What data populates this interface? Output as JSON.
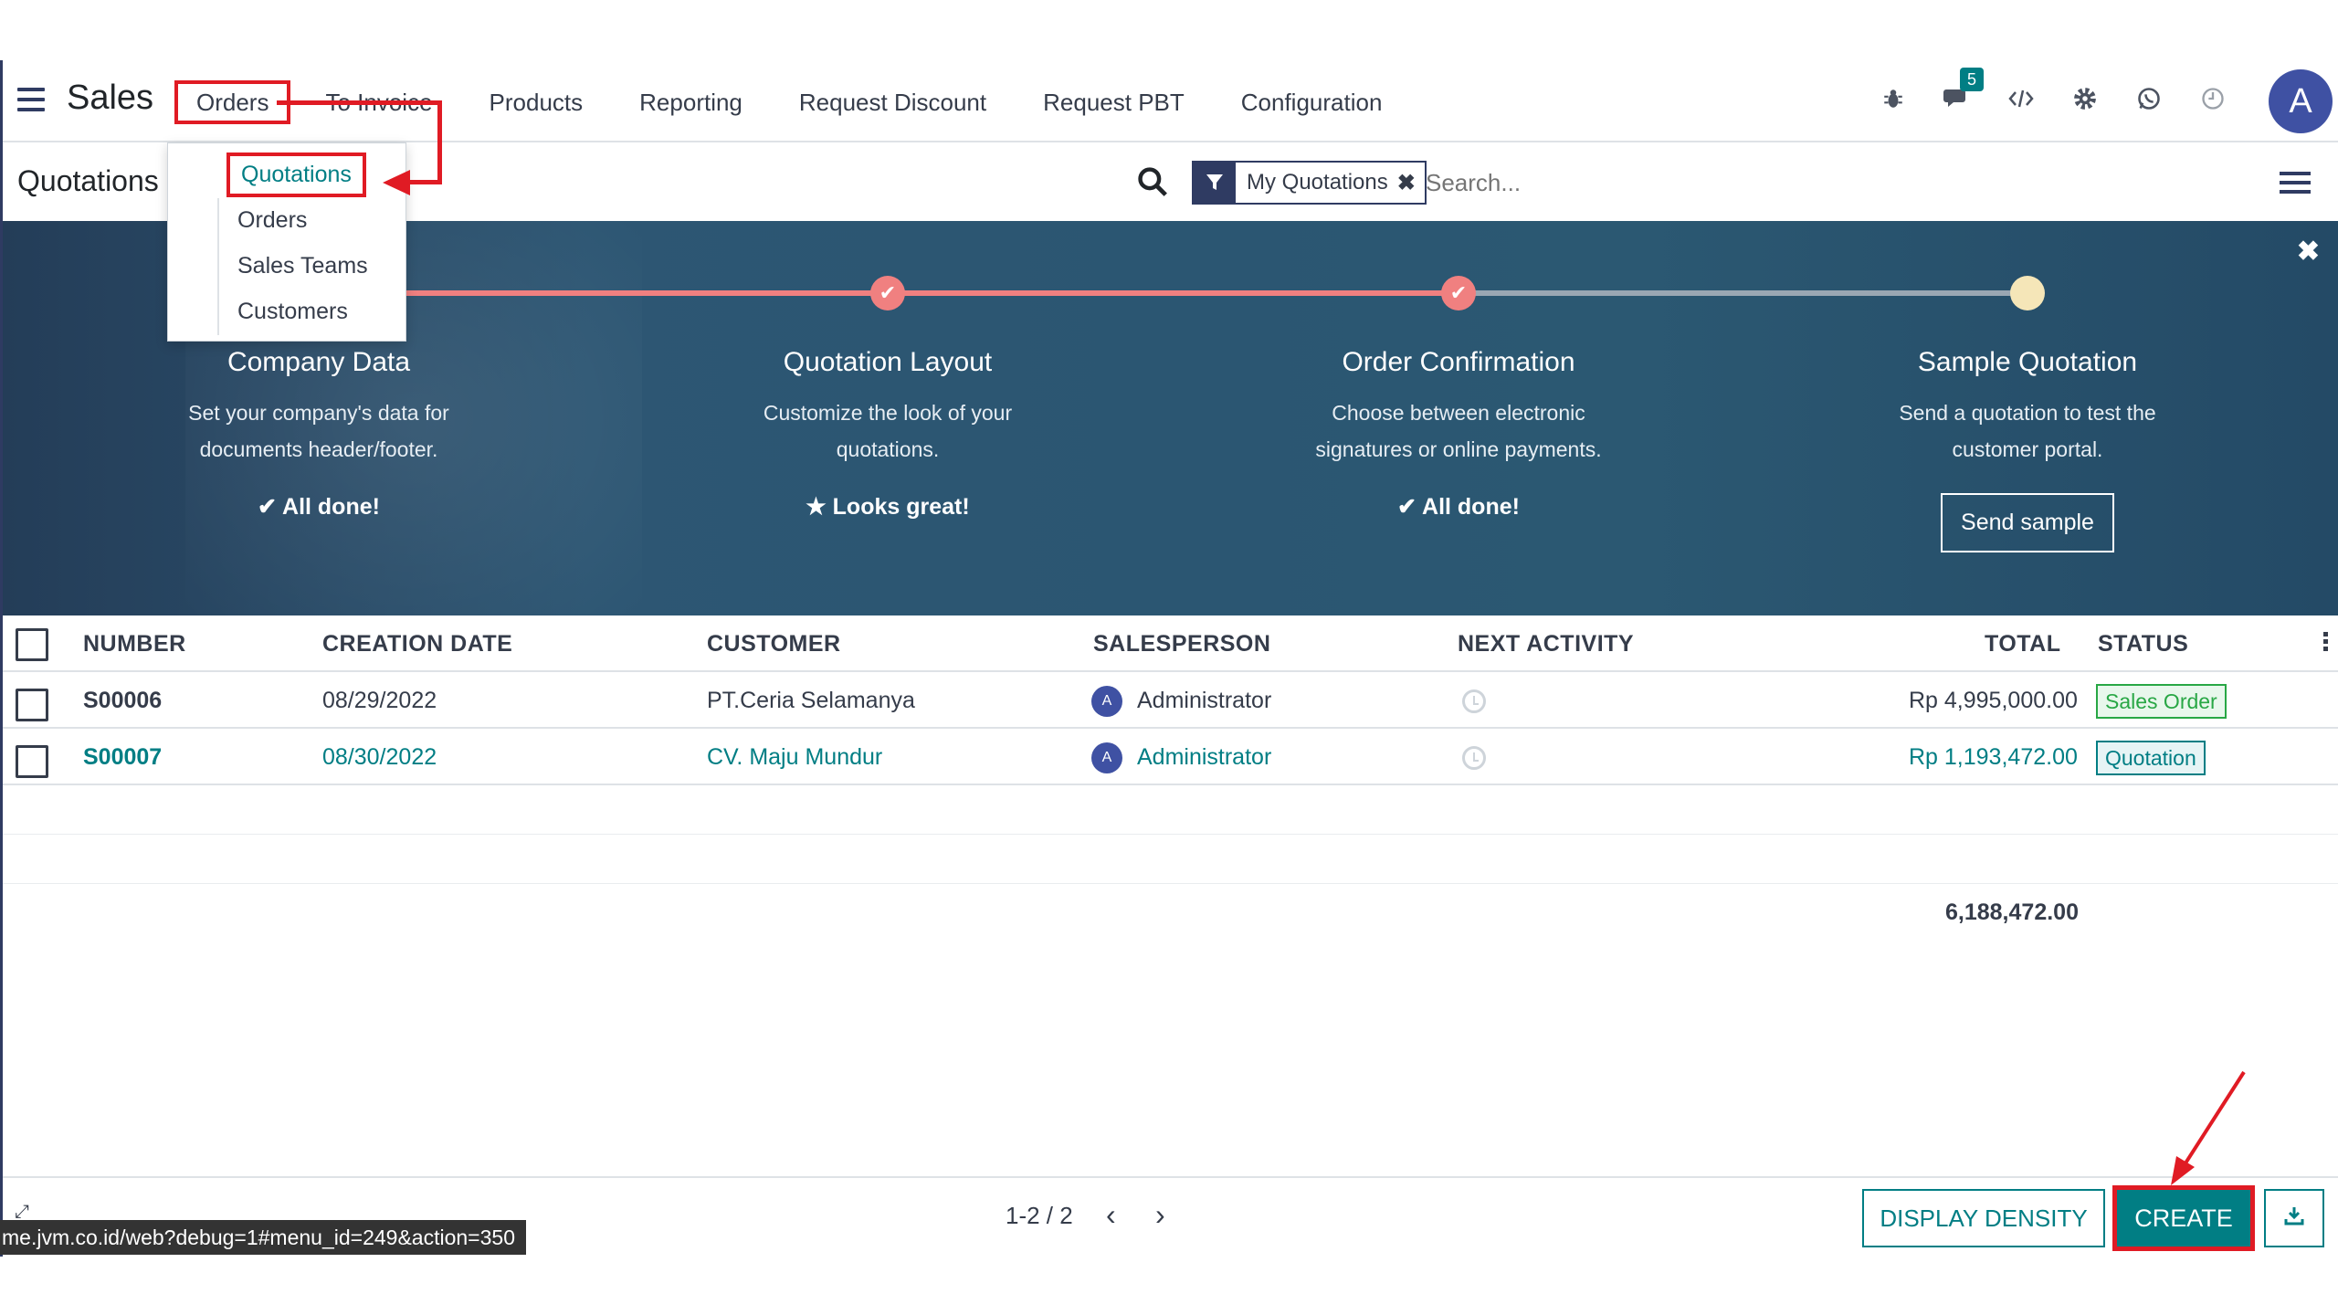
{
  "navbar": {
    "app_name": "Sales",
    "menu": [
      "Orders",
      "To Invoice",
      "Products",
      "Reporting",
      "Request Discount",
      "Request PBT",
      "Configuration"
    ],
    "chat_badge": "5",
    "avatar_letter": "A"
  },
  "dropdown": {
    "items": [
      "Quotations",
      "Orders",
      "Sales Teams",
      "Customers"
    ]
  },
  "control": {
    "breadcrumb": "Quotations",
    "facet": "My Quotations",
    "search_placeholder": "Search..."
  },
  "onboarding": {
    "steps": [
      {
        "title": "Company Data",
        "desc1": "Set your company's data for",
        "desc2": "documents header/footer.",
        "status": "✔ All done!"
      },
      {
        "title": "Quotation Layout",
        "desc1": "Customize the look of your",
        "desc2": "quotations.",
        "status": "★ Looks great!"
      },
      {
        "title": "Order Confirmation",
        "desc1": "Choose between electronic",
        "desc2": "signatures or online payments.",
        "status": "✔ All done!"
      },
      {
        "title": "Sample Quotation",
        "desc1": "Send a quotation to test the",
        "desc2": "customer portal.",
        "button": "Send sample"
      }
    ],
    "colors": {
      "done": "#f08080",
      "todo": "#f5e6b8",
      "track_pending": "#9aa7b3"
    }
  },
  "table": {
    "headers": [
      "NUMBER",
      "CREATION DATE",
      "CUSTOMER",
      "SALESPERSON",
      "NEXT ACTIVITY",
      "TOTAL",
      "STATUS"
    ],
    "rows": [
      {
        "number": "S00006",
        "date": "08/29/2022",
        "customer": "PT.Ceria Selamanya",
        "salesperson": "Administrator",
        "avatar": "A",
        "total": "Rp 4,995,000.00",
        "status": "Sales Order"
      },
      {
        "number": "S00007",
        "date": "08/30/2022",
        "customer": "CV. Maju Mundur",
        "salesperson": "Administrator",
        "avatar": "A",
        "total": "Rp 1,193,472.00",
        "status": "Quotation"
      }
    ],
    "grand_total": "6,188,472.00"
  },
  "footer": {
    "pager": "1-2 / 2",
    "density_label": "DISPLAY DENSITY",
    "create_label": "CREATE",
    "url_tooltip": "me.jvm.co.id/web?debug=1#menu_id=249&action=350"
  }
}
